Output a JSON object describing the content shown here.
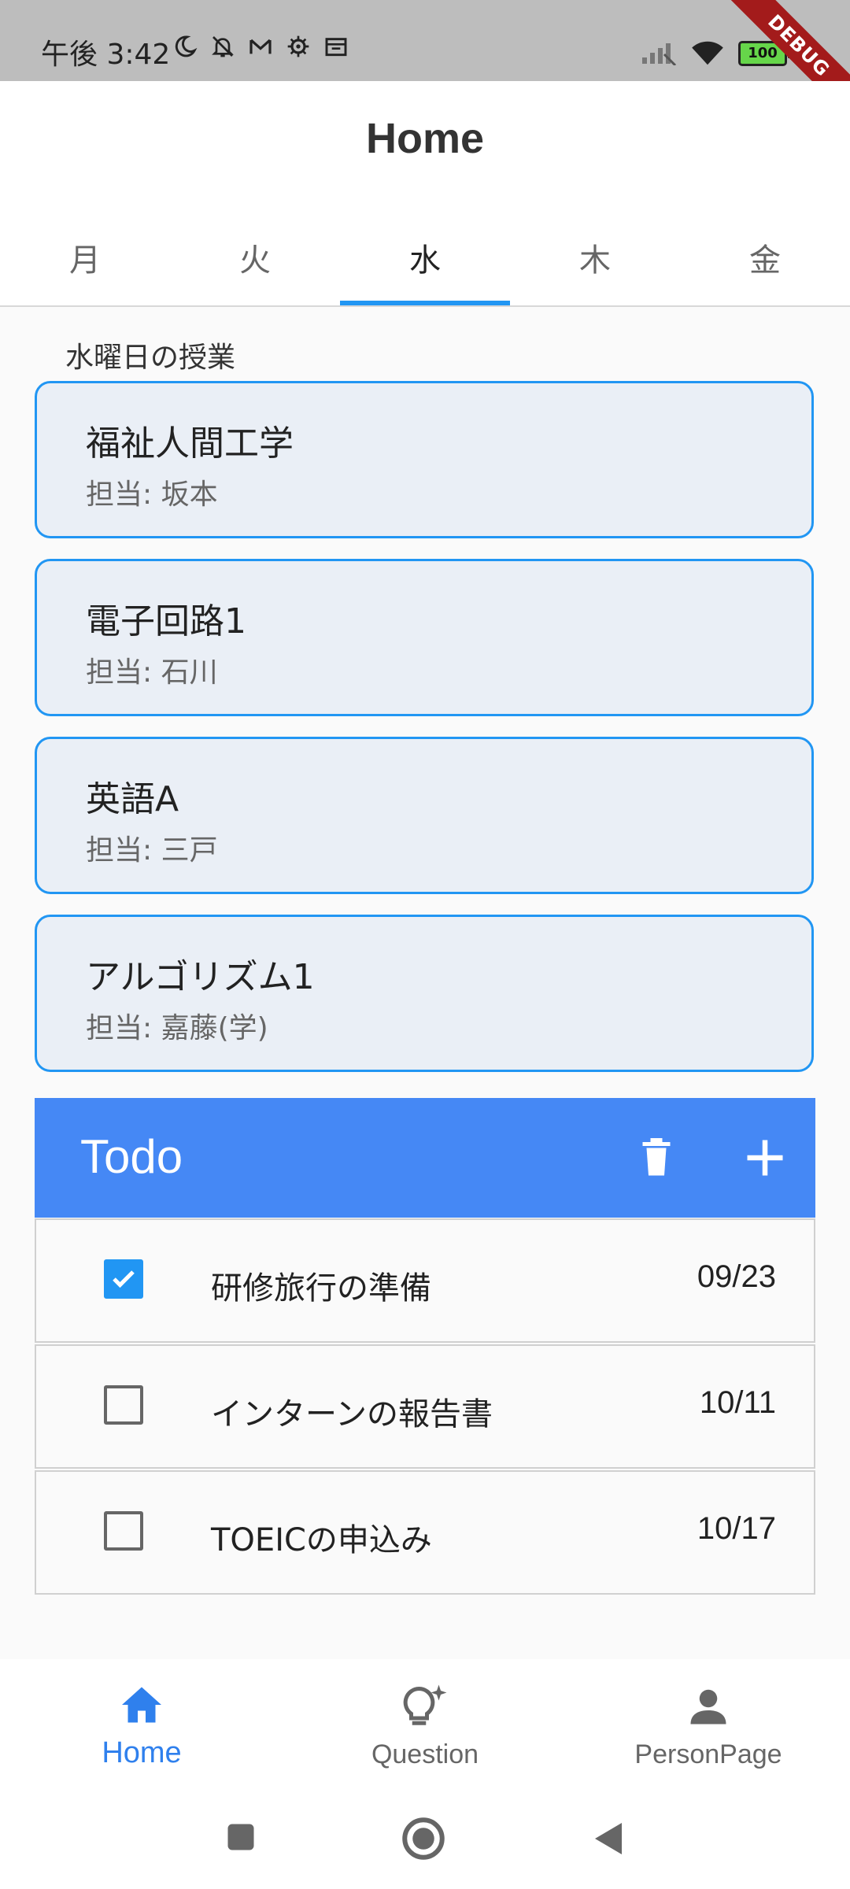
{
  "status_bar": {
    "time": "午後 3:42",
    "battery": "100",
    "debug_label": "DEBUG"
  },
  "app_bar": {
    "title": "Home"
  },
  "day_tabs": [
    {
      "label": "月"
    },
    {
      "label": "火"
    },
    {
      "label": "水",
      "active": true
    },
    {
      "label": "木"
    },
    {
      "label": "金"
    }
  ],
  "section_label": "水曜日の授業",
  "classes": [
    {
      "title": "福祉人間工学",
      "teacher": "担当: 坂本"
    },
    {
      "title": "電子回路1",
      "teacher": "担当: 石川"
    },
    {
      "title": "英語A",
      "teacher": "担当: 三戸"
    },
    {
      "title": "アルゴリズム1",
      "teacher": "担当: 嘉藤(学)"
    }
  ],
  "todo": {
    "title": "Todo",
    "items": [
      {
        "text": "研修旅行の準備",
        "date": "09/23",
        "checked": true
      },
      {
        "text": "インターンの報告書",
        "date": "10/11",
        "checked": false
      },
      {
        "text": "TOEICの申込み",
        "date": "10/17",
        "checked": false
      }
    ]
  },
  "bottom_nav": [
    {
      "label": "Home",
      "icon": "home-icon",
      "active": true
    },
    {
      "label": "Question",
      "icon": "lightbulb-icon",
      "active": false
    },
    {
      "label": "PersonPage",
      "icon": "person-icon",
      "active": false
    }
  ],
  "colors": {
    "accent": "#2196f3",
    "todo_header": "#4588f5",
    "card_bg": "#eaeff6",
    "debug_ribbon": "#a31b1b"
  }
}
